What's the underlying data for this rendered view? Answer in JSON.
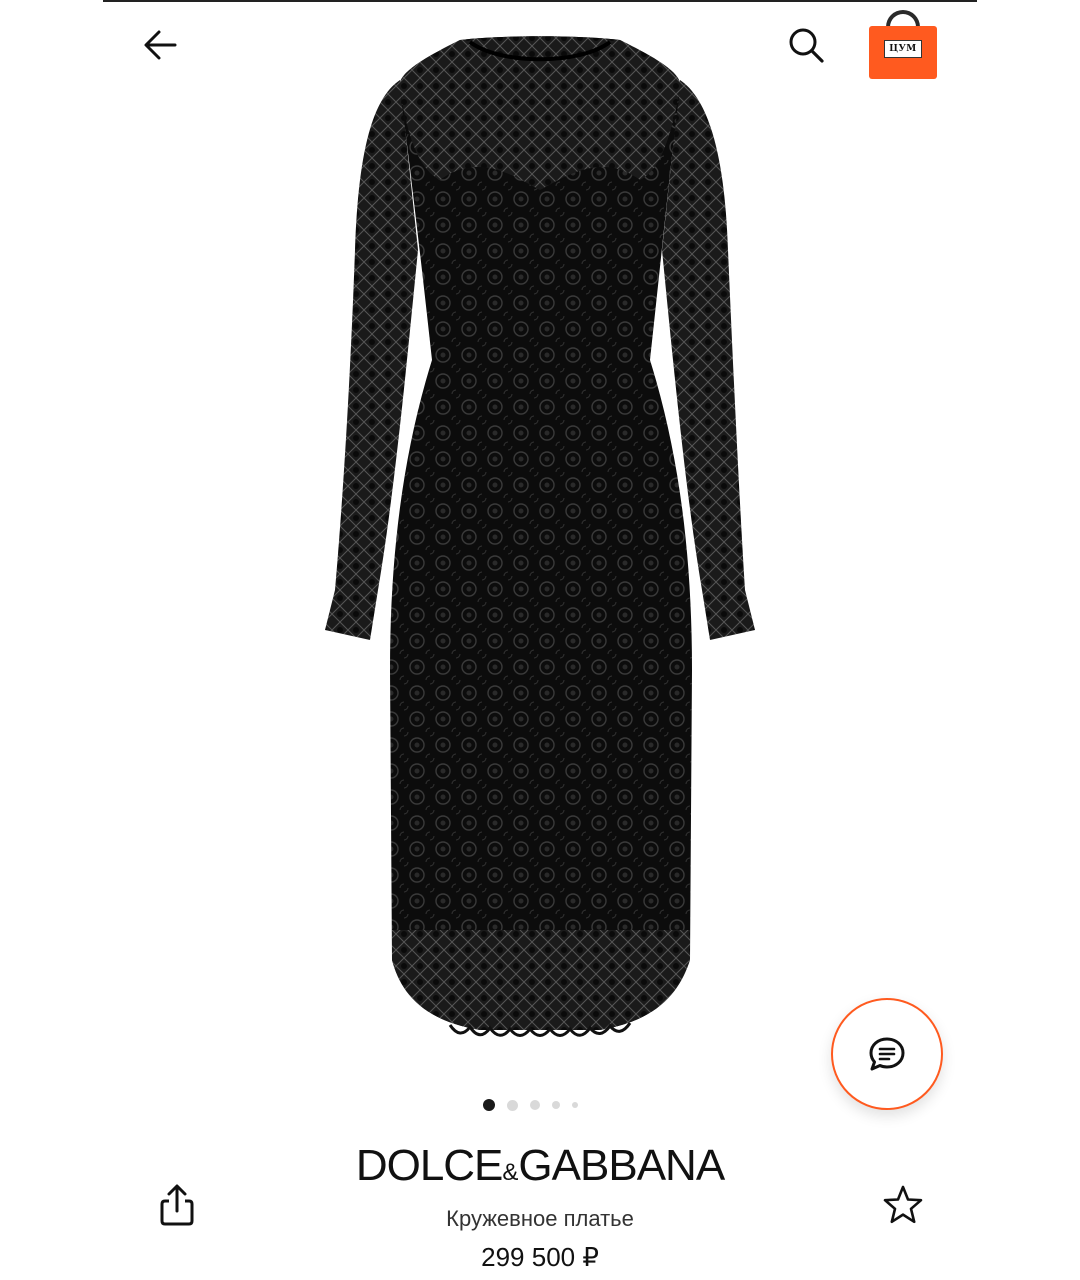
{
  "header": {
    "back_icon": "arrow-left-icon",
    "search_icon": "search-icon",
    "cart_icon": "shopping-bag-icon",
    "cart_logo_text": "ЦУМ",
    "accent_color": "#ff5a1f"
  },
  "gallery": {
    "image_subject": "black lace long-sleeve dress",
    "total_images": 5,
    "active_index": 1
  },
  "chat": {
    "icon": "chat-bubble-icon"
  },
  "product": {
    "brand_part1": "DOLCE",
    "brand_amp": "&",
    "brand_part2": "GABBANA",
    "name": "Кружевное платье",
    "price": "299 500 ₽"
  },
  "actions": {
    "share_icon": "share-icon",
    "favorite_icon": "star-icon"
  }
}
